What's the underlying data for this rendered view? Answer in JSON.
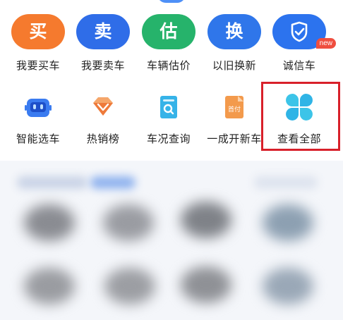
{
  "row1": [
    {
      "glyph": "买",
      "label": "我要买车",
      "color": "#f57a2e"
    },
    {
      "glyph": "卖",
      "label": "我要卖车",
      "color": "#2f6de8"
    },
    {
      "glyph": "估",
      "label": "车辆估价",
      "color": "#26b36b"
    },
    {
      "glyph": "换",
      "label": "以旧换新",
      "color": "#2f76ea"
    },
    {
      "label": "诚信车",
      "badge": "new",
      "icon": "shield-check-icon"
    }
  ],
  "row2": [
    {
      "label": "智能选车",
      "icon": "robot-icon"
    },
    {
      "label": "热销榜",
      "icon": "diamond-icon"
    },
    {
      "label": "车况查询",
      "icon": "document-search-icon"
    },
    {
      "label": "一成开新车",
      "icon": "down-payment-icon",
      "icon_text": "首付"
    },
    {
      "label": "查看全部",
      "icon": "grid-petals-icon"
    }
  ]
}
